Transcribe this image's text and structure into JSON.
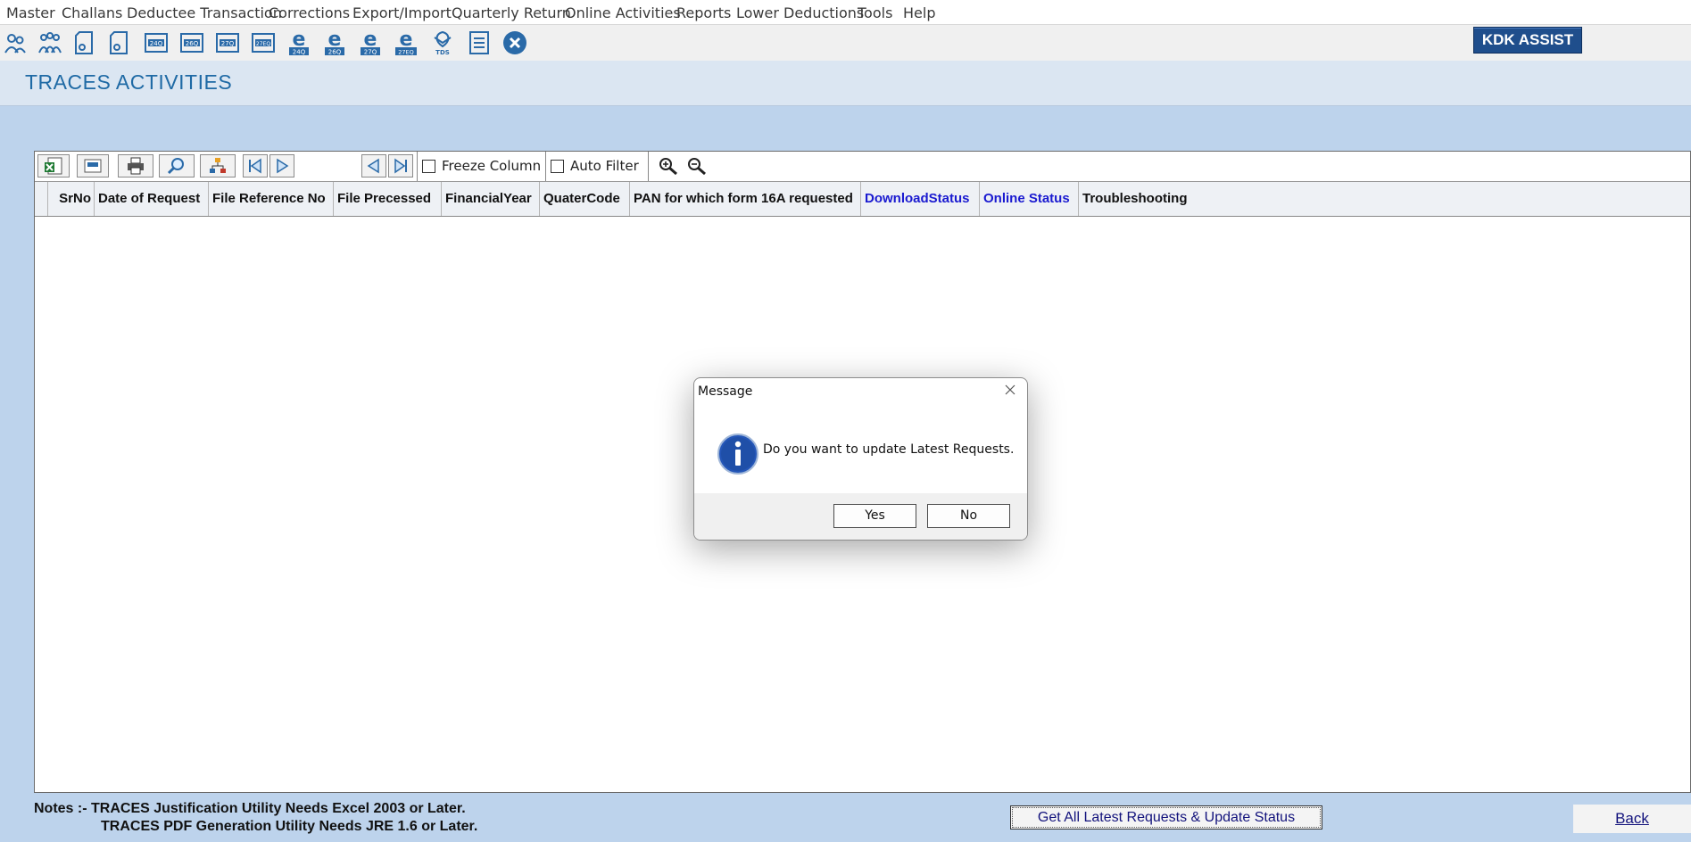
{
  "menu": [
    "Master",
    "Challans",
    "Deductee Transaction",
    "Corrections",
    "Export/Import",
    "Quarterly Return",
    "Online Activities",
    "Reports",
    "Lower Deductions",
    "Tools",
    "Help"
  ],
  "toolbar_icons": [
    {
      "name": "deductor-icon",
      "type": "person"
    },
    {
      "name": "deductee-icon",
      "type": "group"
    },
    {
      "name": "challan-icon",
      "type": "doc"
    },
    {
      "name": "transaction-icon",
      "type": "doc"
    },
    {
      "name": "form-24q-icon",
      "type": "form",
      "label": "24Q"
    },
    {
      "name": "form-26q-icon",
      "type": "form",
      "label": "26Q"
    },
    {
      "name": "form-27q-icon",
      "type": "form",
      "label": "27Q"
    },
    {
      "name": "form-27eq-icon",
      "type": "form",
      "label": "27EQ"
    },
    {
      "name": "efile-24q-icon",
      "type": "efile",
      "label": "24Q"
    },
    {
      "name": "efile-26q-icon",
      "type": "efile",
      "label": "26Q"
    },
    {
      "name": "efile-27q-icon",
      "type": "efile",
      "label": "27Q"
    },
    {
      "name": "efile-27eq-icon",
      "type": "efile",
      "label": "27EQ"
    },
    {
      "name": "tds-icon",
      "type": "tds",
      "label": "TDS"
    },
    {
      "name": "report-icon",
      "type": "report"
    },
    {
      "name": "exit-icon",
      "type": "close"
    }
  ],
  "kdk_assist": "KDK ASSIST",
  "page_title": "TRACES ACTIVITIES",
  "grid": {
    "freeze_label": "Freeze Column",
    "filter_label": "Auto Filter",
    "columns": [
      {
        "label": "",
        "highlight": false
      },
      {
        "label": "SrNo",
        "highlight": false
      },
      {
        "label": "Date of Request",
        "highlight": false
      },
      {
        "label": "File Reference No",
        "highlight": false
      },
      {
        "label": "File Precessed",
        "highlight": false
      },
      {
        "label": "FinancialYear",
        "highlight": false
      },
      {
        "label": "QuaterCode",
        "highlight": false
      },
      {
        "label": "PAN for which form 16A requested",
        "highlight": false
      },
      {
        "label": "DownloadStatus",
        "highlight": true
      },
      {
        "label": "Online Status",
        "highlight": true
      },
      {
        "label": "Troubleshooting",
        "highlight": false
      }
    ]
  },
  "notes": {
    "line1": "Notes :- TRACES Justification Utility Needs Excel 2003 or Later.",
    "line2": "TRACES PDF Generation Utility Needs JRE 1.6 or Later."
  },
  "update_button": "Get All Latest Requests & Update Status",
  "back_button": "Back",
  "dialog": {
    "title": "Message",
    "message": "Do you want to update Latest Requests.",
    "yes": "Yes",
    "no": "No"
  },
  "colors": {
    "accent_title": "#1f6aa5",
    "highlight_column": "#1a1ad0",
    "background": "#bdd3ec",
    "kdk": "#1f4e8c"
  }
}
